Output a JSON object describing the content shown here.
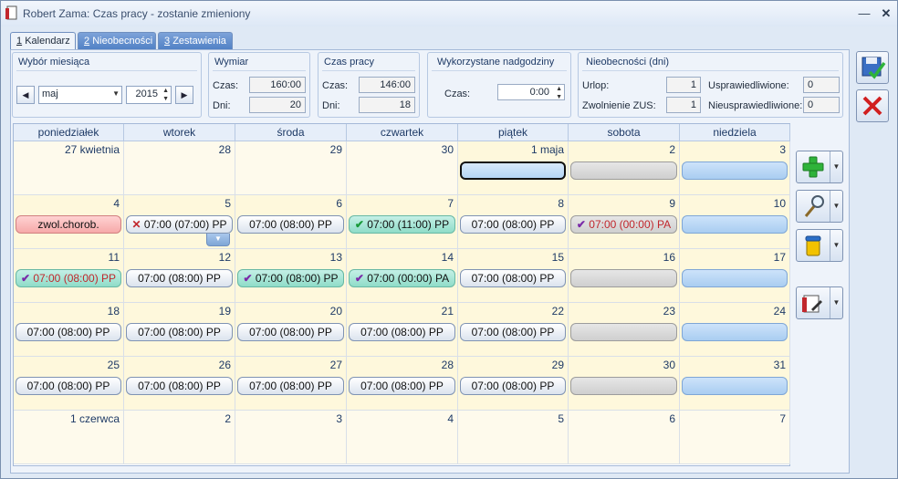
{
  "window": {
    "title": "Robert Zama: Czas pracy - zostanie zmieniony"
  },
  "tabs": [
    {
      "key": "1",
      "label": "Kalendarz"
    },
    {
      "key": "2",
      "label": "Nieobecności"
    },
    {
      "key": "3",
      "label": "Zestawienia"
    }
  ],
  "month_selector": {
    "title": "Wybór miesiąca",
    "month": "maj",
    "year": "2015"
  },
  "wymiar": {
    "title": "Wymiar",
    "czas_label": "Czas:",
    "czas": "160:00",
    "dni_label": "Dni:",
    "dni": "20"
  },
  "czas_pracy": {
    "title": "Czas pracy",
    "czas_label": "Czas:",
    "czas": "146:00",
    "dni_label": "Dni:",
    "dni": "18"
  },
  "nadgodziny": {
    "title": "Wykorzystane nadgodziny",
    "czas_label": "Czas:",
    "czas": "0:00"
  },
  "nieobecnosci": {
    "title": "Nieobecności (dni)",
    "urlop_label": "Urlop:",
    "urlop": "1",
    "zus_label": "Zwolnienie ZUS:",
    "zus": "1",
    "usprawiedliwione_label": "Usprawiedliwione:",
    "usprawiedliwione": "0",
    "nieusprawiedliwione_label": "Nieusprawiedliwione:",
    "nieusprawiedliwione": "0"
  },
  "calendar": {
    "weekdays": [
      "poniedziałek",
      "wtorek",
      "środa",
      "czwartek",
      "piątek",
      "sobota",
      "niedziela"
    ],
    "weeks": [
      [
        {
          "day": "27 kwietnia",
          "prev": true
        },
        {
          "day": "28",
          "prev": true
        },
        {
          "day": "29",
          "prev": true
        },
        {
          "day": "30",
          "prev": true
        },
        {
          "day": "1 maja",
          "style": "selected",
          "text": ""
        },
        {
          "day": "2",
          "style": "gray",
          "text": ""
        },
        {
          "day": "3",
          "style": "blue",
          "text": ""
        }
      ],
      [
        {
          "day": "4",
          "style": "pink",
          "text": "zwol.chorob."
        },
        {
          "day": "5",
          "style": "white",
          "mark": "x",
          "text": "07:00 (07:00) PP",
          "dropdown": true
        },
        {
          "day": "6",
          "style": "white",
          "text": "07:00 (08:00) PP"
        },
        {
          "day": "7",
          "style": "teal",
          "mark": "green",
          "text": "07:00 (11:00) PP"
        },
        {
          "day": "8",
          "style": "white",
          "text": "07:00 (08:00) PP"
        },
        {
          "day": "9",
          "style": "gray",
          "mark": "purple",
          "text": "07:00 (00:00) PA",
          "red": true
        },
        {
          "day": "10",
          "style": "blue",
          "text": ""
        }
      ],
      [
        {
          "day": "11",
          "style": "teal",
          "mark": "purple",
          "text": "07:00 (08:00) PP",
          "red": true
        },
        {
          "day": "12",
          "style": "white",
          "text": "07:00 (08:00) PP"
        },
        {
          "day": "13",
          "style": "teal",
          "mark": "purple",
          "text": "07:00 (08:00) PP"
        },
        {
          "day": "14",
          "style": "teal",
          "mark": "purple",
          "text": "07:00 (00:00) PA"
        },
        {
          "day": "15",
          "style": "white",
          "text": "07:00 (08:00) PP"
        },
        {
          "day": "16",
          "style": "gray",
          "text": ""
        },
        {
          "day": "17",
          "style": "blue",
          "text": ""
        }
      ],
      [
        {
          "day": "18",
          "style": "white",
          "text": "07:00 (08:00) PP"
        },
        {
          "day": "19",
          "style": "white",
          "text": "07:00 (08:00) PP"
        },
        {
          "day": "20",
          "style": "white",
          "text": "07:00 (08:00) PP"
        },
        {
          "day": "21",
          "style": "white",
          "text": "07:00 (08:00) PP"
        },
        {
          "day": "22",
          "style": "white",
          "text": "07:00 (08:00) PP"
        },
        {
          "day": "23",
          "style": "gray",
          "text": ""
        },
        {
          "day": "24",
          "style": "blue",
          "text": ""
        }
      ],
      [
        {
          "day": "25",
          "style": "white",
          "text": "07:00 (08:00) PP"
        },
        {
          "day": "26",
          "style": "white",
          "text": "07:00 (08:00) PP"
        },
        {
          "day": "27",
          "style": "white",
          "text": "07:00 (08:00) PP"
        },
        {
          "day": "28",
          "style": "white",
          "text": "07:00 (08:00) PP"
        },
        {
          "day": "29",
          "style": "white",
          "text": "07:00 (08:00) PP"
        },
        {
          "day": "30",
          "style": "gray",
          "text": ""
        },
        {
          "day": "31",
          "style": "blue",
          "text": ""
        }
      ],
      [
        {
          "day": "1 czerwca",
          "next": true
        },
        {
          "day": "2",
          "next": true
        },
        {
          "day": "3",
          "next": true
        },
        {
          "day": "4",
          "next": true
        },
        {
          "day": "5",
          "next": true
        },
        {
          "day": "6",
          "next": true
        },
        {
          "day": "7",
          "next": true
        }
      ]
    ]
  },
  "side_buttons": [
    {
      "name": "add-button",
      "icon": "plus-icon"
    },
    {
      "name": "view-button",
      "icon": "magnifier-icon"
    },
    {
      "name": "delete-button",
      "icon": "trash-icon"
    },
    {
      "name": "print-button",
      "icon": "print-icon"
    }
  ],
  "actions": {
    "save_icon": "save-icon",
    "cancel_icon": "cancel-icon"
  }
}
